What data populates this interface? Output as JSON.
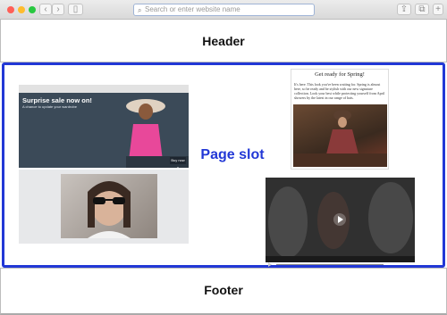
{
  "browser": {
    "address_placeholder": "Search or enter website name",
    "colors": {
      "close": "#ff5f57",
      "minimize": "#febc2e",
      "zoom": "#28c840"
    }
  },
  "layout": {
    "header": "Header",
    "page_slot": "Page slot",
    "footer": "Footer",
    "slot_border_color": "#2238d6"
  },
  "cards": {
    "sale": {
      "title": "Surprise sale now on!",
      "subtitle": "A chance to update your wardrobe",
      "button": "Buy now »"
    },
    "article": {
      "title": "Get ready for Spring!",
      "body": "It's here. This look you've been waiting for. Spring is almost here, so be ready and be stylish with our new signature collection. Look your best while protecting yourself from April showers by the latest in our range of hats."
    }
  }
}
